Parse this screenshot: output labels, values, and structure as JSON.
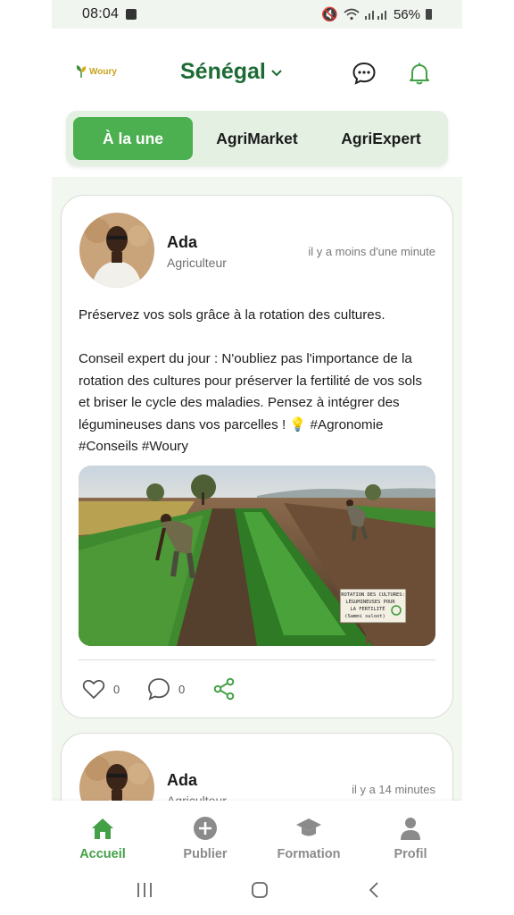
{
  "status_bar": {
    "time": "08:04",
    "battery": "56%"
  },
  "header": {
    "logo_text": "Woury",
    "country": "Sénégal",
    "icons": [
      "chat-bubble-icon",
      "bell-icon"
    ]
  },
  "tabs": [
    {
      "label": "À la une",
      "active": true
    },
    {
      "label": "AgriMarket",
      "active": false
    },
    {
      "label": "AgriExpert",
      "active": false
    }
  ],
  "posts": [
    {
      "author": "Ada",
      "role": "Agriculteur",
      "time": "il y a moins d'une minute",
      "paragraph_1": "Préservez vos sols grâce à la rotation des cultures.",
      "paragraph_2": "Conseil expert du jour : N'oubliez pas l'importance de la rotation des cultures pour préserver la fertilité de vos sols et briser le cycle des maladies. Pensez à intégrer des légumineuses dans vos parcelles ! 💡 #Agronomie #Conseils #Woury",
      "image_sign": {
        "line1": "ROTATION DES CULTURES:",
        "line2": "LÉGUMINEUSES POUR",
        "line3": "LA FERTILITÉ",
        "line4": "(Sammi suloot)"
      },
      "likes": "0",
      "comments": "0"
    },
    {
      "author": "Ada",
      "role": "Agriculteur",
      "time": "il y a 14 minutes"
    }
  ],
  "bottom_nav": [
    {
      "label": "Accueil",
      "icon": "home-icon",
      "active": true
    },
    {
      "label": "Publier",
      "icon": "plus-circle-icon",
      "active": false
    },
    {
      "label": "Formation",
      "icon": "graduation-cap-icon",
      "active": false
    },
    {
      "label": "Profil",
      "icon": "person-icon",
      "active": false
    }
  ],
  "colors": {
    "brand_green": "#4caf50",
    "title_green": "#1d6b34",
    "feed_bg": "#f2f8ef",
    "tab_bg": "#e3f0e2"
  }
}
